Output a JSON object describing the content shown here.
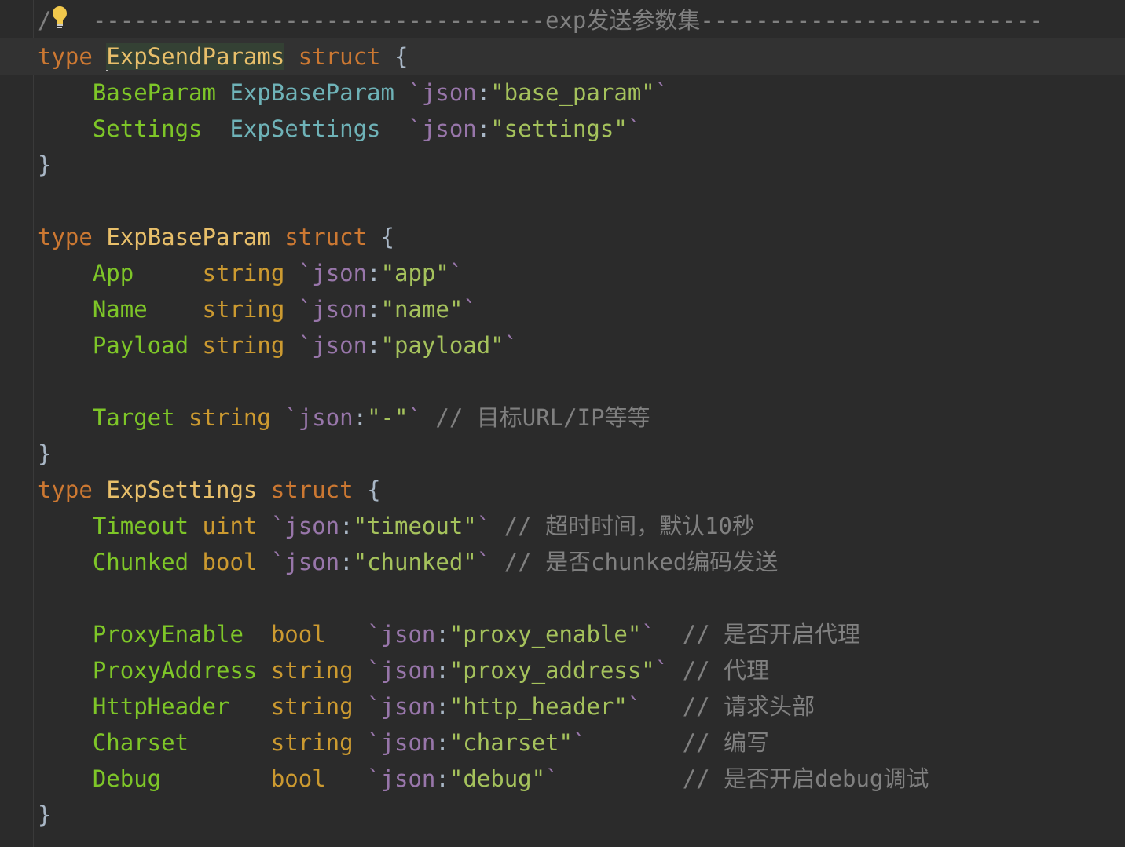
{
  "editor": {
    "lines": [
      {
        "row": 0,
        "tokens": [
          {
            "cls": "cmt",
            "text": "/"
          },
          {
            "cls": "cmt",
            "text": "   ---------------------------------"
          },
          {
            "cls": "cmt",
            "text": "exp发送参数集"
          },
          {
            "cls": "cmt",
            "text": "-------------------------"
          }
        ]
      },
      {
        "row": 1,
        "tokens": [
          {
            "cls": "kw",
            "text": "type "
          },
          {
            "cls": "cursor",
            "text": ""
          },
          {
            "cls": "selname",
            "text": "ExpSendParams"
          },
          {
            "cls": "kw",
            "text": " struct "
          },
          {
            "cls": "plain",
            "text": "{"
          }
        ]
      },
      {
        "row": 2,
        "tokens": [
          {
            "cls": "plain",
            "text": "    "
          },
          {
            "cls": "fname",
            "text": "BaseParam"
          },
          {
            "cls": "plain",
            "text": " "
          },
          {
            "cls": "ftype-user",
            "text": "ExpBaseParam"
          },
          {
            "cls": "plain",
            "text": " "
          },
          {
            "cls": "bq",
            "text": "`json"
          },
          {
            "cls": "colon",
            "text": ":"
          },
          {
            "cls": "str",
            "text": "\"base_param\""
          },
          {
            "cls": "bq",
            "text": "`"
          }
        ]
      },
      {
        "row": 3,
        "tokens": [
          {
            "cls": "plain",
            "text": "    "
          },
          {
            "cls": "fname",
            "text": "Settings"
          },
          {
            "cls": "plain",
            "text": "  "
          },
          {
            "cls": "ftype-user",
            "text": "ExpSettings"
          },
          {
            "cls": "plain",
            "text": "  "
          },
          {
            "cls": "bq",
            "text": "`json"
          },
          {
            "cls": "colon",
            "text": ":"
          },
          {
            "cls": "str",
            "text": "\"settings\""
          },
          {
            "cls": "bq",
            "text": "`"
          }
        ]
      },
      {
        "row": 4,
        "tokens": [
          {
            "cls": "plain",
            "text": "}"
          }
        ]
      },
      {
        "row": 5,
        "tokens": []
      },
      {
        "row": 6,
        "tokens": [
          {
            "cls": "kw",
            "text": "type "
          },
          {
            "cls": "tname",
            "text": "ExpBaseParam"
          },
          {
            "cls": "kw",
            "text": " struct "
          },
          {
            "cls": "plain",
            "text": "{"
          }
        ]
      },
      {
        "row": 7,
        "tokens": [
          {
            "cls": "plain",
            "text": "    "
          },
          {
            "cls": "fname",
            "text": "App"
          },
          {
            "cls": "plain",
            "text": "     "
          },
          {
            "cls": "ftype-builtin",
            "text": "string"
          },
          {
            "cls": "plain",
            "text": " "
          },
          {
            "cls": "bq",
            "text": "`json"
          },
          {
            "cls": "colon",
            "text": ":"
          },
          {
            "cls": "str",
            "text": "\"app\""
          },
          {
            "cls": "bq",
            "text": "`"
          }
        ]
      },
      {
        "row": 8,
        "tokens": [
          {
            "cls": "plain",
            "text": "    "
          },
          {
            "cls": "fname",
            "text": "Name"
          },
          {
            "cls": "plain",
            "text": "    "
          },
          {
            "cls": "ftype-builtin",
            "text": "string"
          },
          {
            "cls": "plain",
            "text": " "
          },
          {
            "cls": "bq",
            "text": "`json"
          },
          {
            "cls": "colon",
            "text": ":"
          },
          {
            "cls": "str",
            "text": "\"name\""
          },
          {
            "cls": "bq",
            "text": "`"
          }
        ]
      },
      {
        "row": 9,
        "tokens": [
          {
            "cls": "plain",
            "text": "    "
          },
          {
            "cls": "fname",
            "text": "Payload"
          },
          {
            "cls": "plain",
            "text": " "
          },
          {
            "cls": "ftype-builtin",
            "text": "string"
          },
          {
            "cls": "plain",
            "text": " "
          },
          {
            "cls": "bq",
            "text": "`json"
          },
          {
            "cls": "colon",
            "text": ":"
          },
          {
            "cls": "str",
            "text": "\"payload\""
          },
          {
            "cls": "bq",
            "text": "`"
          }
        ]
      },
      {
        "row": 10,
        "tokens": []
      },
      {
        "row": 11,
        "tokens": [
          {
            "cls": "plain",
            "text": "    "
          },
          {
            "cls": "fname",
            "text": "Target"
          },
          {
            "cls": "plain",
            "text": " "
          },
          {
            "cls": "ftype-builtin",
            "text": "string"
          },
          {
            "cls": "plain",
            "text": " "
          },
          {
            "cls": "bq",
            "text": "`json"
          },
          {
            "cls": "colon",
            "text": ":"
          },
          {
            "cls": "str",
            "text": "\"-\""
          },
          {
            "cls": "bq",
            "text": "`"
          },
          {
            "cls": "plain",
            "text": " "
          },
          {
            "cls": "cmt",
            "text": "// 目标URL/IP等等"
          }
        ]
      },
      {
        "row": 12,
        "tokens": [
          {
            "cls": "plain",
            "text": "}"
          }
        ]
      },
      {
        "row": 13,
        "tokens": [
          {
            "cls": "kw",
            "text": "type "
          },
          {
            "cls": "tname",
            "text": "ExpSettings"
          },
          {
            "cls": "kw",
            "text": " struct "
          },
          {
            "cls": "plain",
            "text": "{"
          }
        ]
      },
      {
        "row": 14,
        "tokens": [
          {
            "cls": "plain",
            "text": "    "
          },
          {
            "cls": "fname",
            "text": "Timeout"
          },
          {
            "cls": "plain",
            "text": " "
          },
          {
            "cls": "ftype-builtin",
            "text": "uint"
          },
          {
            "cls": "plain",
            "text": " "
          },
          {
            "cls": "bq",
            "text": "`json"
          },
          {
            "cls": "colon",
            "text": ":"
          },
          {
            "cls": "str",
            "text": "\"timeout\""
          },
          {
            "cls": "bq",
            "text": "`"
          },
          {
            "cls": "plain",
            "text": " "
          },
          {
            "cls": "cmt",
            "text": "// 超时时间，默认10秒"
          }
        ]
      },
      {
        "row": 15,
        "tokens": [
          {
            "cls": "plain",
            "text": "    "
          },
          {
            "cls": "fname",
            "text": "Chunked"
          },
          {
            "cls": "plain",
            "text": " "
          },
          {
            "cls": "ftype-builtin",
            "text": "bool"
          },
          {
            "cls": "plain",
            "text": " "
          },
          {
            "cls": "bq",
            "text": "`json"
          },
          {
            "cls": "colon",
            "text": ":"
          },
          {
            "cls": "str",
            "text": "\"chunked\""
          },
          {
            "cls": "bq",
            "text": "`"
          },
          {
            "cls": "plain",
            "text": " "
          },
          {
            "cls": "cmt",
            "text": "// 是否chunked编码发送"
          }
        ]
      },
      {
        "row": 16,
        "tokens": []
      },
      {
        "row": 17,
        "tokens": [
          {
            "cls": "plain",
            "text": "    "
          },
          {
            "cls": "fname",
            "text": "ProxyEnable"
          },
          {
            "cls": "plain",
            "text": "  "
          },
          {
            "cls": "ftype-builtin",
            "text": "bool"
          },
          {
            "cls": "plain",
            "text": "   "
          },
          {
            "cls": "bq",
            "text": "`json"
          },
          {
            "cls": "colon",
            "text": ":"
          },
          {
            "cls": "str",
            "text": "\"proxy_enable\""
          },
          {
            "cls": "bq",
            "text": "`"
          },
          {
            "cls": "plain",
            "text": "  "
          },
          {
            "cls": "cmt",
            "text": "// 是否开启代理"
          }
        ]
      },
      {
        "row": 18,
        "tokens": [
          {
            "cls": "plain",
            "text": "    "
          },
          {
            "cls": "fname",
            "text": "ProxyAddress"
          },
          {
            "cls": "plain",
            "text": " "
          },
          {
            "cls": "ftype-builtin",
            "text": "string"
          },
          {
            "cls": "plain",
            "text": " "
          },
          {
            "cls": "bq",
            "text": "`json"
          },
          {
            "cls": "colon",
            "text": ":"
          },
          {
            "cls": "str",
            "text": "\"proxy_address\""
          },
          {
            "cls": "bq",
            "text": "`"
          },
          {
            "cls": "plain",
            "text": " "
          },
          {
            "cls": "cmt",
            "text": "// 代理"
          }
        ]
      },
      {
        "row": 19,
        "tokens": [
          {
            "cls": "plain",
            "text": "    "
          },
          {
            "cls": "fname",
            "text": "HttpHeader"
          },
          {
            "cls": "plain",
            "text": "   "
          },
          {
            "cls": "ftype-builtin",
            "text": "string"
          },
          {
            "cls": "plain",
            "text": " "
          },
          {
            "cls": "bq",
            "text": "`json"
          },
          {
            "cls": "colon",
            "text": ":"
          },
          {
            "cls": "str",
            "text": "\"http_header\""
          },
          {
            "cls": "bq",
            "text": "`"
          },
          {
            "cls": "plain",
            "text": "   "
          },
          {
            "cls": "cmt",
            "text": "// 请求头部"
          }
        ]
      },
      {
        "row": 20,
        "tokens": [
          {
            "cls": "plain",
            "text": "    "
          },
          {
            "cls": "fname",
            "text": "Charset"
          },
          {
            "cls": "plain",
            "text": "      "
          },
          {
            "cls": "ftype-builtin",
            "text": "string"
          },
          {
            "cls": "plain",
            "text": " "
          },
          {
            "cls": "bq",
            "text": "`json"
          },
          {
            "cls": "colon",
            "text": ":"
          },
          {
            "cls": "str",
            "text": "\"charset\""
          },
          {
            "cls": "bq",
            "text": "`"
          },
          {
            "cls": "plain",
            "text": "       "
          },
          {
            "cls": "cmt",
            "text": "// 编写"
          }
        ]
      },
      {
        "row": 21,
        "tokens": [
          {
            "cls": "plain",
            "text": "    "
          },
          {
            "cls": "fname",
            "text": "Debug"
          },
          {
            "cls": "plain",
            "text": "        "
          },
          {
            "cls": "ftype-builtin",
            "text": "bool"
          },
          {
            "cls": "plain",
            "text": "   "
          },
          {
            "cls": "bq",
            "text": "`json"
          },
          {
            "cls": "colon",
            "text": ":"
          },
          {
            "cls": "str",
            "text": "\"debug\""
          },
          {
            "cls": "bq",
            "text": "`"
          },
          {
            "cls": "plain",
            "text": "         "
          },
          {
            "cls": "cmt",
            "text": "// 是否开启debug调试"
          }
        ]
      },
      {
        "row": 22,
        "tokens": [
          {
            "cls": "plain",
            "text": "}"
          }
        ]
      }
    ]
  },
  "icons": {
    "intention_bulb": "lightbulb-icon"
  },
  "colors": {
    "background": "#2b2b2b",
    "keyword": "#cc7832",
    "type_name": "#e8bf6a",
    "field_name": "#7ec628",
    "builtin_type": "#cc9a30",
    "user_type": "#6fb3b8",
    "tag_key": "#9876aa",
    "string": "#a5c25c",
    "comment": "#808080"
  }
}
